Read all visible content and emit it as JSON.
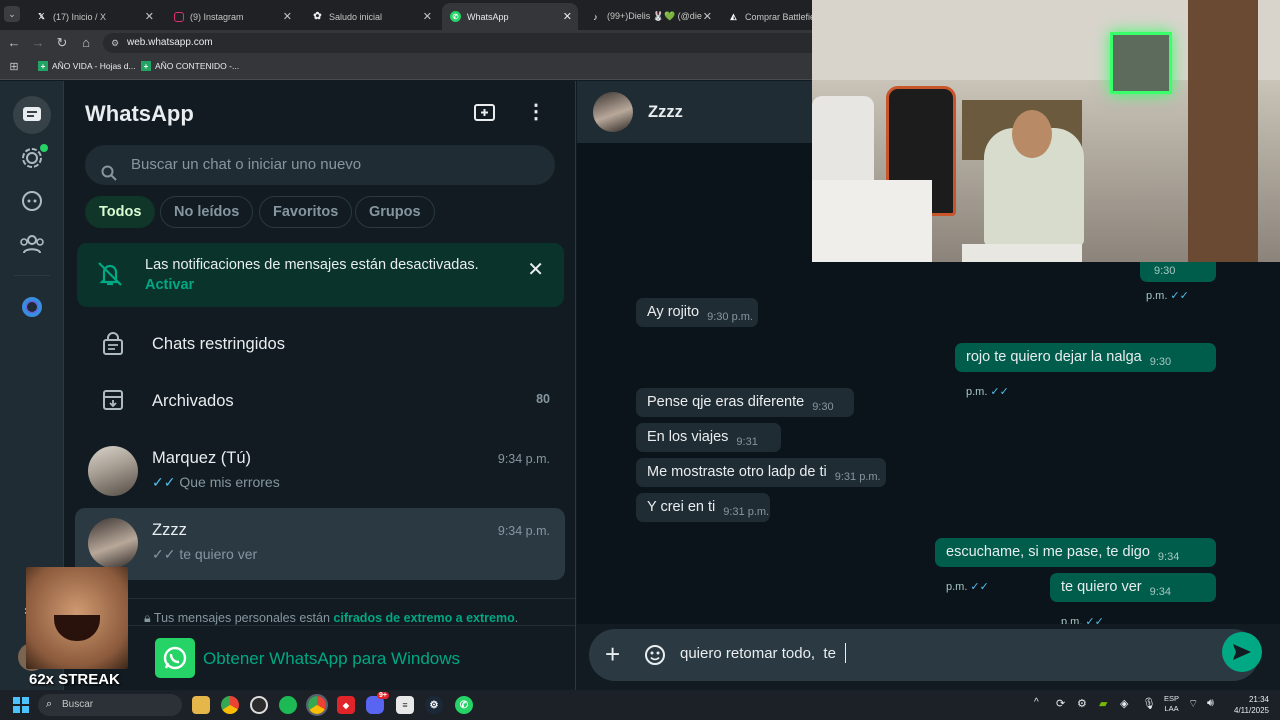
{
  "browser": {
    "tabs": [
      {
        "label": "(17) Inicio / X",
        "icon": "x-logo-icon"
      },
      {
        "label": "(9) Instagram",
        "icon": "instagram-icon"
      },
      {
        "label": "Saludo inicial",
        "icon": "chatgpt-icon"
      },
      {
        "label": "WhatsApp",
        "icon": "whatsapp-icon",
        "active": true
      },
      {
        "label": "(99+)Dielis 🐰💚 (@die",
        "icon": "tiktok-icon"
      },
      {
        "label": "Comprar Battlefield™",
        "icon": "ea-icon"
      }
    ],
    "url": "web.whatsapp.com",
    "bookmarks": [
      {
        "label": "AÑO VIDA - Hojas d..."
      },
      {
        "label": "AÑO CONTENIDO -..."
      }
    ]
  },
  "whatsapp": {
    "title": "WhatsApp",
    "search_placeholder": "Buscar un chat o iniciar uno nuevo",
    "filters": [
      "Todos",
      "No leídos",
      "Favoritos",
      "Grupos"
    ],
    "notification": {
      "text": "Las notificaciones de mensajes están desactivadas.",
      "action": "Activar"
    },
    "restricted_label": "Chats restringidos",
    "archived_label": "Archivados",
    "archived_count": "80",
    "chats": [
      {
        "name": "Marquez (Tú)",
        "time": "9:34 p.m.",
        "preview": "Que mis errores"
      },
      {
        "name": "Zzzz",
        "time": "9:34 p.m.",
        "preview": "te quiero ver"
      }
    ],
    "encryption_prefix": "Tus mensajes personales están ",
    "encryption_link": "cifrados de extremo a extremo",
    "encryption_suffix": ".",
    "promo": "Obtener WhatsApp para Windows"
  },
  "conversation": {
    "contact_name": "Zzzz",
    "messages": [
      {
        "dir": "out",
        "text": "",
        "time": "9:30 p.m."
      },
      {
        "dir": "in",
        "text": "Ay rojito",
        "time": "9:30 p.m."
      },
      {
        "dir": "out",
        "text": "rojo te quiero dejar la nalga",
        "time": "9:30 p.m."
      },
      {
        "dir": "in",
        "text": "Pense qje eras diferente",
        "time": "9:30 p.m."
      },
      {
        "dir": "in",
        "text": "En los viajes",
        "time": "9:31 p.m."
      },
      {
        "dir": "in",
        "text": "Me mostraste otro ladp de ti",
        "time": "9:31 p.m."
      },
      {
        "dir": "in",
        "text": "Y crei en ti",
        "time": "9:31 p.m."
      },
      {
        "dir": "out",
        "text": "escuchame, si me pase, te digo",
        "time": "9:34 p.m."
      },
      {
        "dir": "out",
        "text": "te quiero ver",
        "time": "9:34 p.m."
      }
    ],
    "draft": "quiero retomar todo,  te"
  },
  "overlay": {
    "streak": "62x STREAK"
  },
  "taskbar": {
    "search_placeholder": "Buscar",
    "lang_top": "ESP",
    "lang_bottom": "LAA",
    "time": "21:34",
    "date": "4/11/2025",
    "discord_badge": "9+"
  },
  "colors": {
    "accent": "#00a884",
    "outgoing_bubble": "#005c4b",
    "incoming_bubble": "#202c33",
    "background": "#111b21"
  }
}
